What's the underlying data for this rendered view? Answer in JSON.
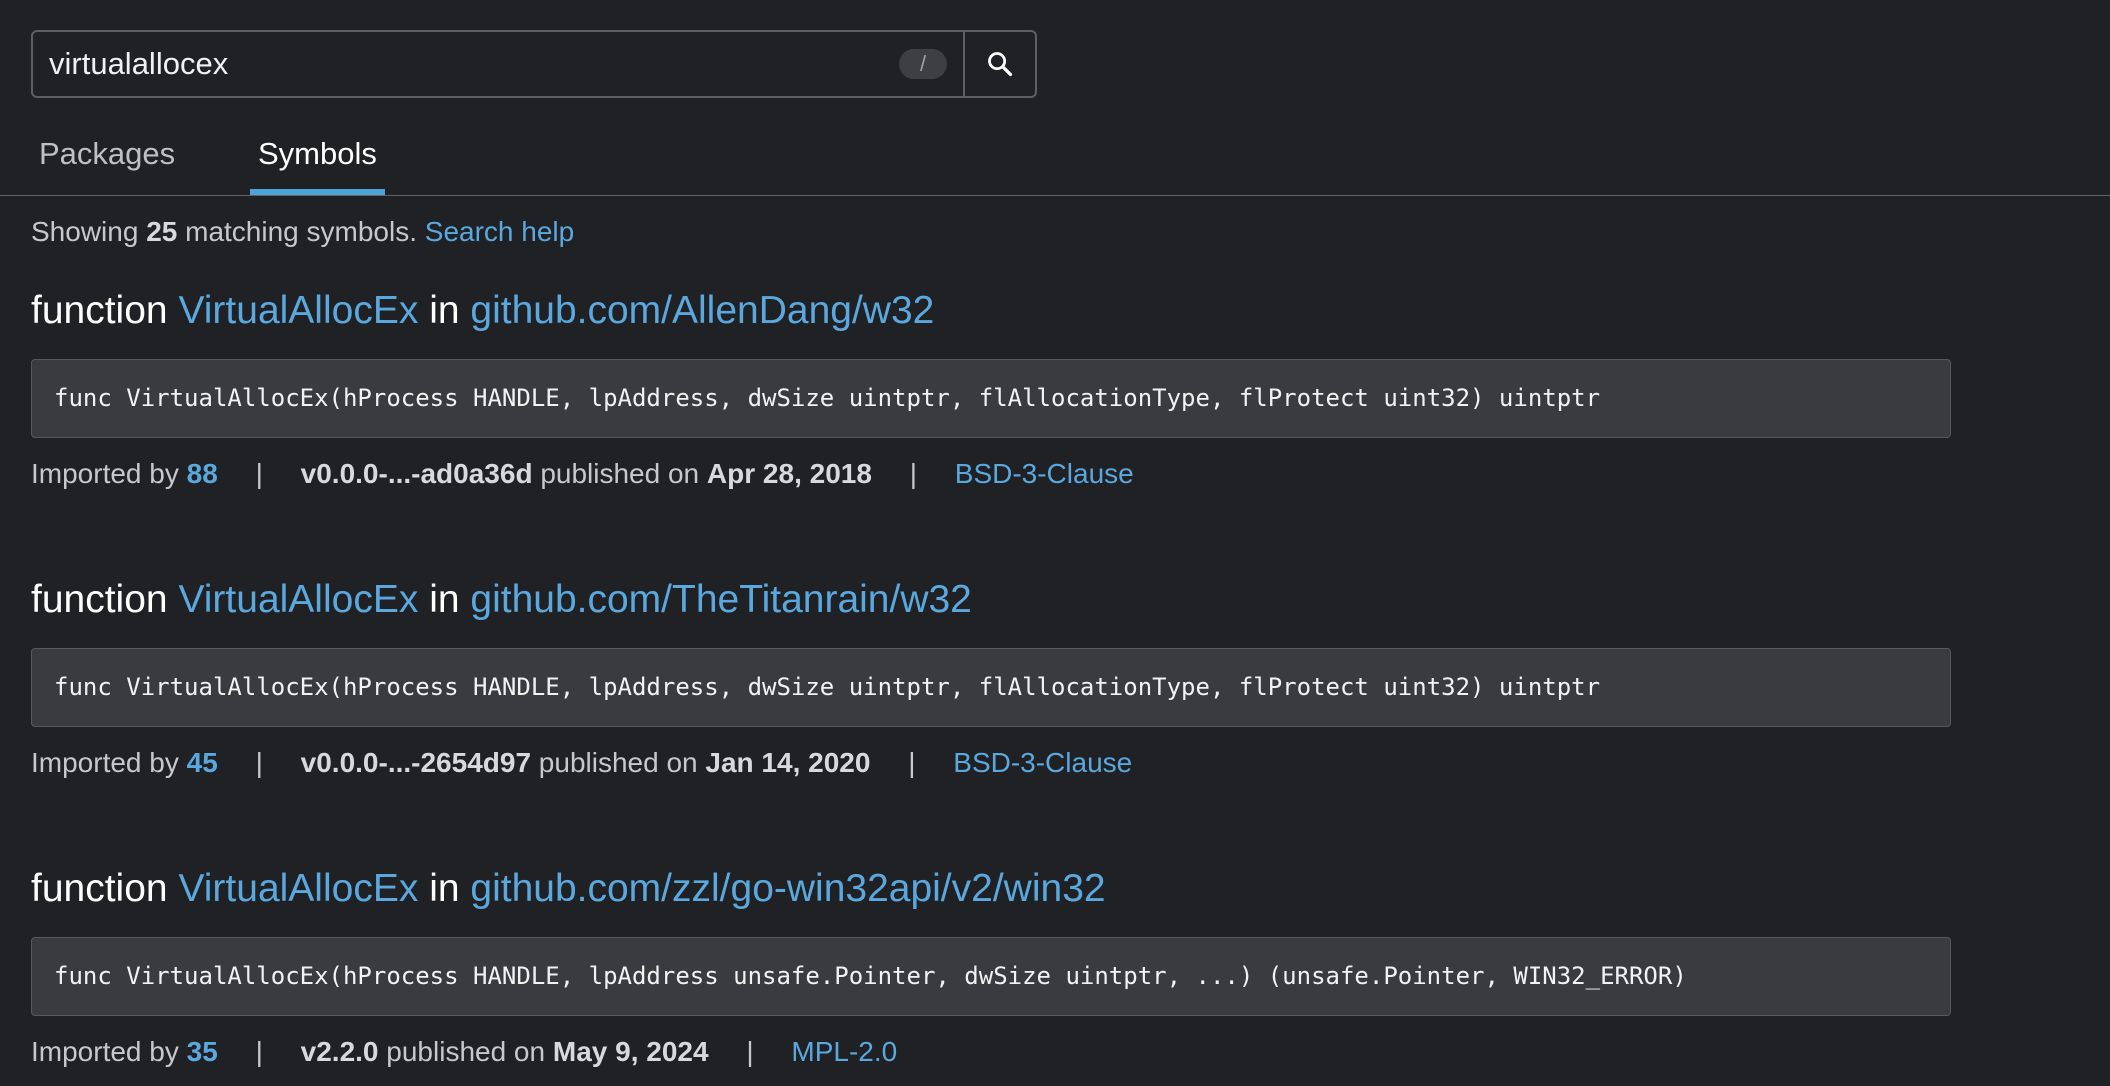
{
  "search": {
    "value": "virtualallocex",
    "shortcut_key": "/",
    "search_icon": "search-icon"
  },
  "tabs": [
    {
      "label": "Packages",
      "active": false
    },
    {
      "label": "Symbols",
      "active": true
    }
  ],
  "summary": {
    "prefix": "Showing",
    "count": "25",
    "suffix": "matching symbols.",
    "help_link": "Search help"
  },
  "results": [
    {
      "kind": "function",
      "symbol": "VirtualAllocEx",
      "in_word": "in",
      "package": "github.com/AllenDang/w32",
      "signature": "func VirtualAllocEx(hProcess HANDLE, lpAddress, dwSize uintptr, flAllocationType, flProtect uint32) uintptr",
      "imported_by_label": "Imported by",
      "imported_by": "88",
      "version": "v0.0.0-...-ad0a36d",
      "published_label": "published on",
      "date": "Apr 28, 2018",
      "license": "BSD-3-Clause"
    },
    {
      "kind": "function",
      "symbol": "VirtualAllocEx",
      "in_word": "in",
      "package": "github.com/TheTitanrain/w32",
      "signature": "func VirtualAllocEx(hProcess HANDLE, lpAddress, dwSize uintptr, flAllocationType, flProtect uint32) uintptr",
      "imported_by_label": "Imported by",
      "imported_by": "45",
      "version": "v0.0.0-...-2654d97",
      "published_label": "published on",
      "date": "Jan 14, 2020",
      "license": "BSD-3-Clause"
    },
    {
      "kind": "function",
      "symbol": "VirtualAllocEx",
      "in_word": "in",
      "package": "github.com/zzl/go-win32api/v2/win32",
      "signature": "func VirtualAllocEx(hProcess HANDLE, lpAddress unsafe.Pointer, dwSize uintptr, ...) (unsafe.Pointer, WIN32_ERROR)",
      "imported_by_label": "Imported by",
      "imported_by": "35",
      "version": "v2.2.0",
      "published_label": "published on",
      "date": "May 9, 2024",
      "license": "MPL-2.0"
    }
  ],
  "colors": {
    "background": "#202124",
    "link": "#5aa8de",
    "tab_indicator": "#4ea3d8",
    "code_background": "#3a3b3e"
  }
}
